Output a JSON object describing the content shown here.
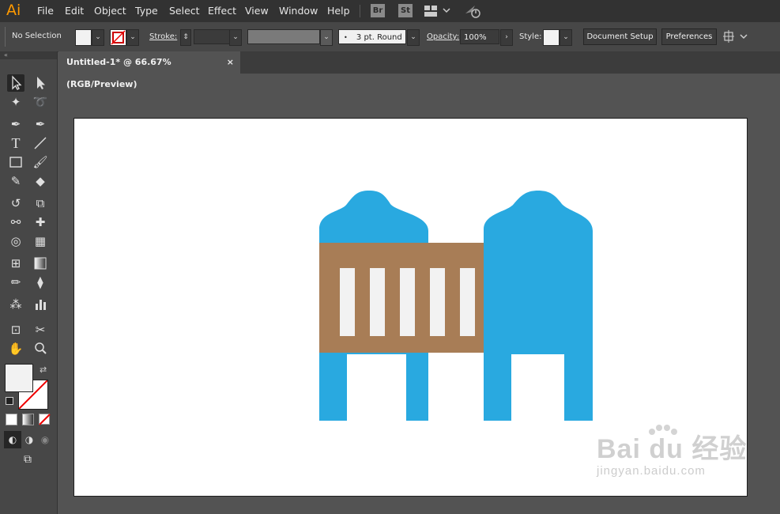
{
  "app": {
    "logo": "Ai"
  },
  "menu": [
    "File",
    "Edit",
    "Object",
    "Type",
    "Select",
    "Effect",
    "View",
    "Window",
    "Help"
  ],
  "app_buttons": {
    "bridge": "Br",
    "stock": "St"
  },
  "control": {
    "selection": "No Selection",
    "stroke_label": "Stroke:",
    "brush": "3 pt. Round",
    "opacity_label": "Opacity:",
    "opacity_value": "100%",
    "style_label": "Style:",
    "document_setup": "Document Setup",
    "preferences": "Preferences"
  },
  "tab": {
    "title": "Untitled-1* @ 66.67% (RGB/Preview)",
    "close": "×"
  },
  "colors": {
    "accent_blue": "#29a9e0",
    "wood_brown": "#a87d56",
    "slat_white": "#f2f2f2",
    "canvas_bg": "#535353",
    "artboard": "#ffffff"
  },
  "watermark": {
    "main": "Bai du 经验",
    "sub": "jingyan.baidu.com"
  }
}
